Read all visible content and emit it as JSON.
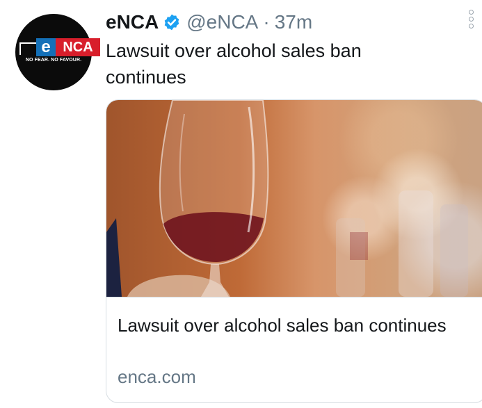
{
  "avatar": {
    "logo_e": "e",
    "logo_nca": "NCA",
    "tagline": "NO FEAR. NO FAVOUR."
  },
  "tweet": {
    "display_name": "eNCA",
    "handle": "@eNCA",
    "separator": "·",
    "time": "37m",
    "text": "Lawsuit over alcohol sales ban continues",
    "verified_icon": "verified-badge-icon",
    "more_icon": "more-options-icon"
  },
  "card": {
    "title": "Lawsuit over alcohol sales ban continues",
    "domain": "enca.com",
    "image": "wine-glass-photo"
  },
  "colors": {
    "verified_blue": "#1da1f2",
    "secondary_text": "#657786",
    "primary_text": "#14171a",
    "logo_blue": "#1470b8",
    "logo_red": "#d81e2b"
  }
}
